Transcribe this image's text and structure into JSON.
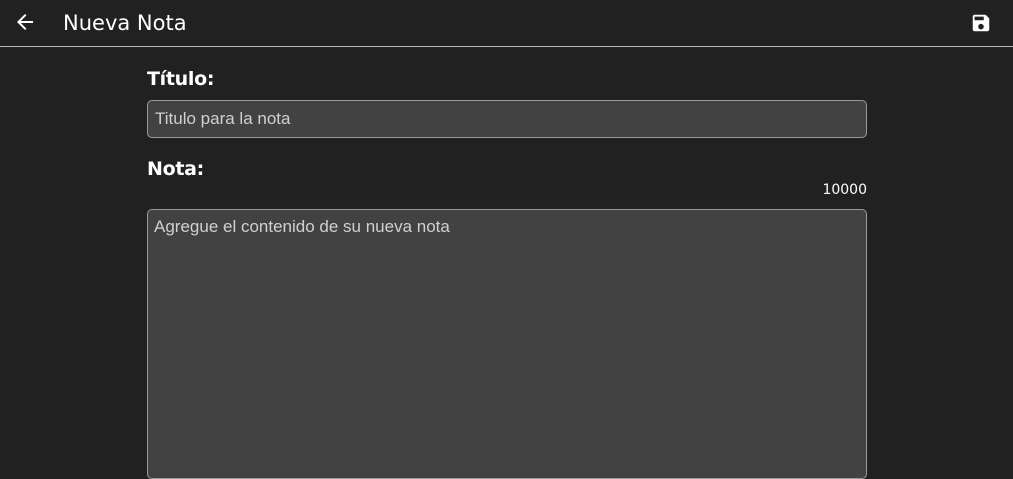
{
  "header": {
    "title": "Nueva Nota",
    "back_icon": "arrow-left-icon",
    "save_icon": "save-icon"
  },
  "form": {
    "title_label": "Título:",
    "title_placeholder": "Titulo para la nota",
    "title_value": "",
    "note_label": "Nota:",
    "note_counter": "10000",
    "note_placeholder": "Agregue el contenido de su nueva nota",
    "note_value": ""
  },
  "colors": {
    "background": "#212121",
    "field_background": "#424242",
    "field_border": "#9a9a9a",
    "text": "#ffffff"
  }
}
